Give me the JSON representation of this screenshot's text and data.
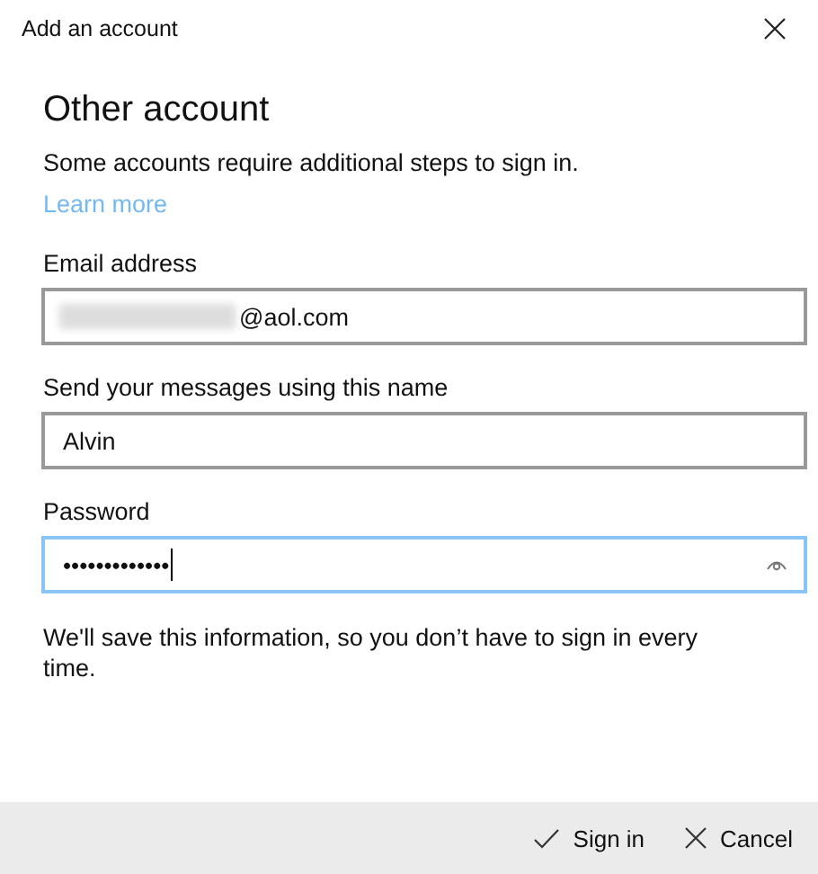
{
  "window": {
    "title": "Add an account"
  },
  "heading": "Other account",
  "description": "Some accounts require additional steps to sign in.",
  "learn_more": "Learn more",
  "fields": [
    {
      "label": "Email address",
      "kind": "email",
      "redacted": true,
      "value": "@aol.com",
      "focused": false
    },
    {
      "label": "Send your messages using this name",
      "kind": "text",
      "redacted": false,
      "value": "Alvin",
      "focused": false
    },
    {
      "label": "Password",
      "kind": "password",
      "redacted": false,
      "value": "•••••••••••••",
      "focused": true
    }
  ],
  "note": "We'll save this information, so you don’t have to sign in every time.",
  "buttons": [
    {
      "label": "Sign in",
      "kind": "confirm"
    },
    {
      "label": "Cancel",
      "kind": "cancel"
    }
  ]
}
